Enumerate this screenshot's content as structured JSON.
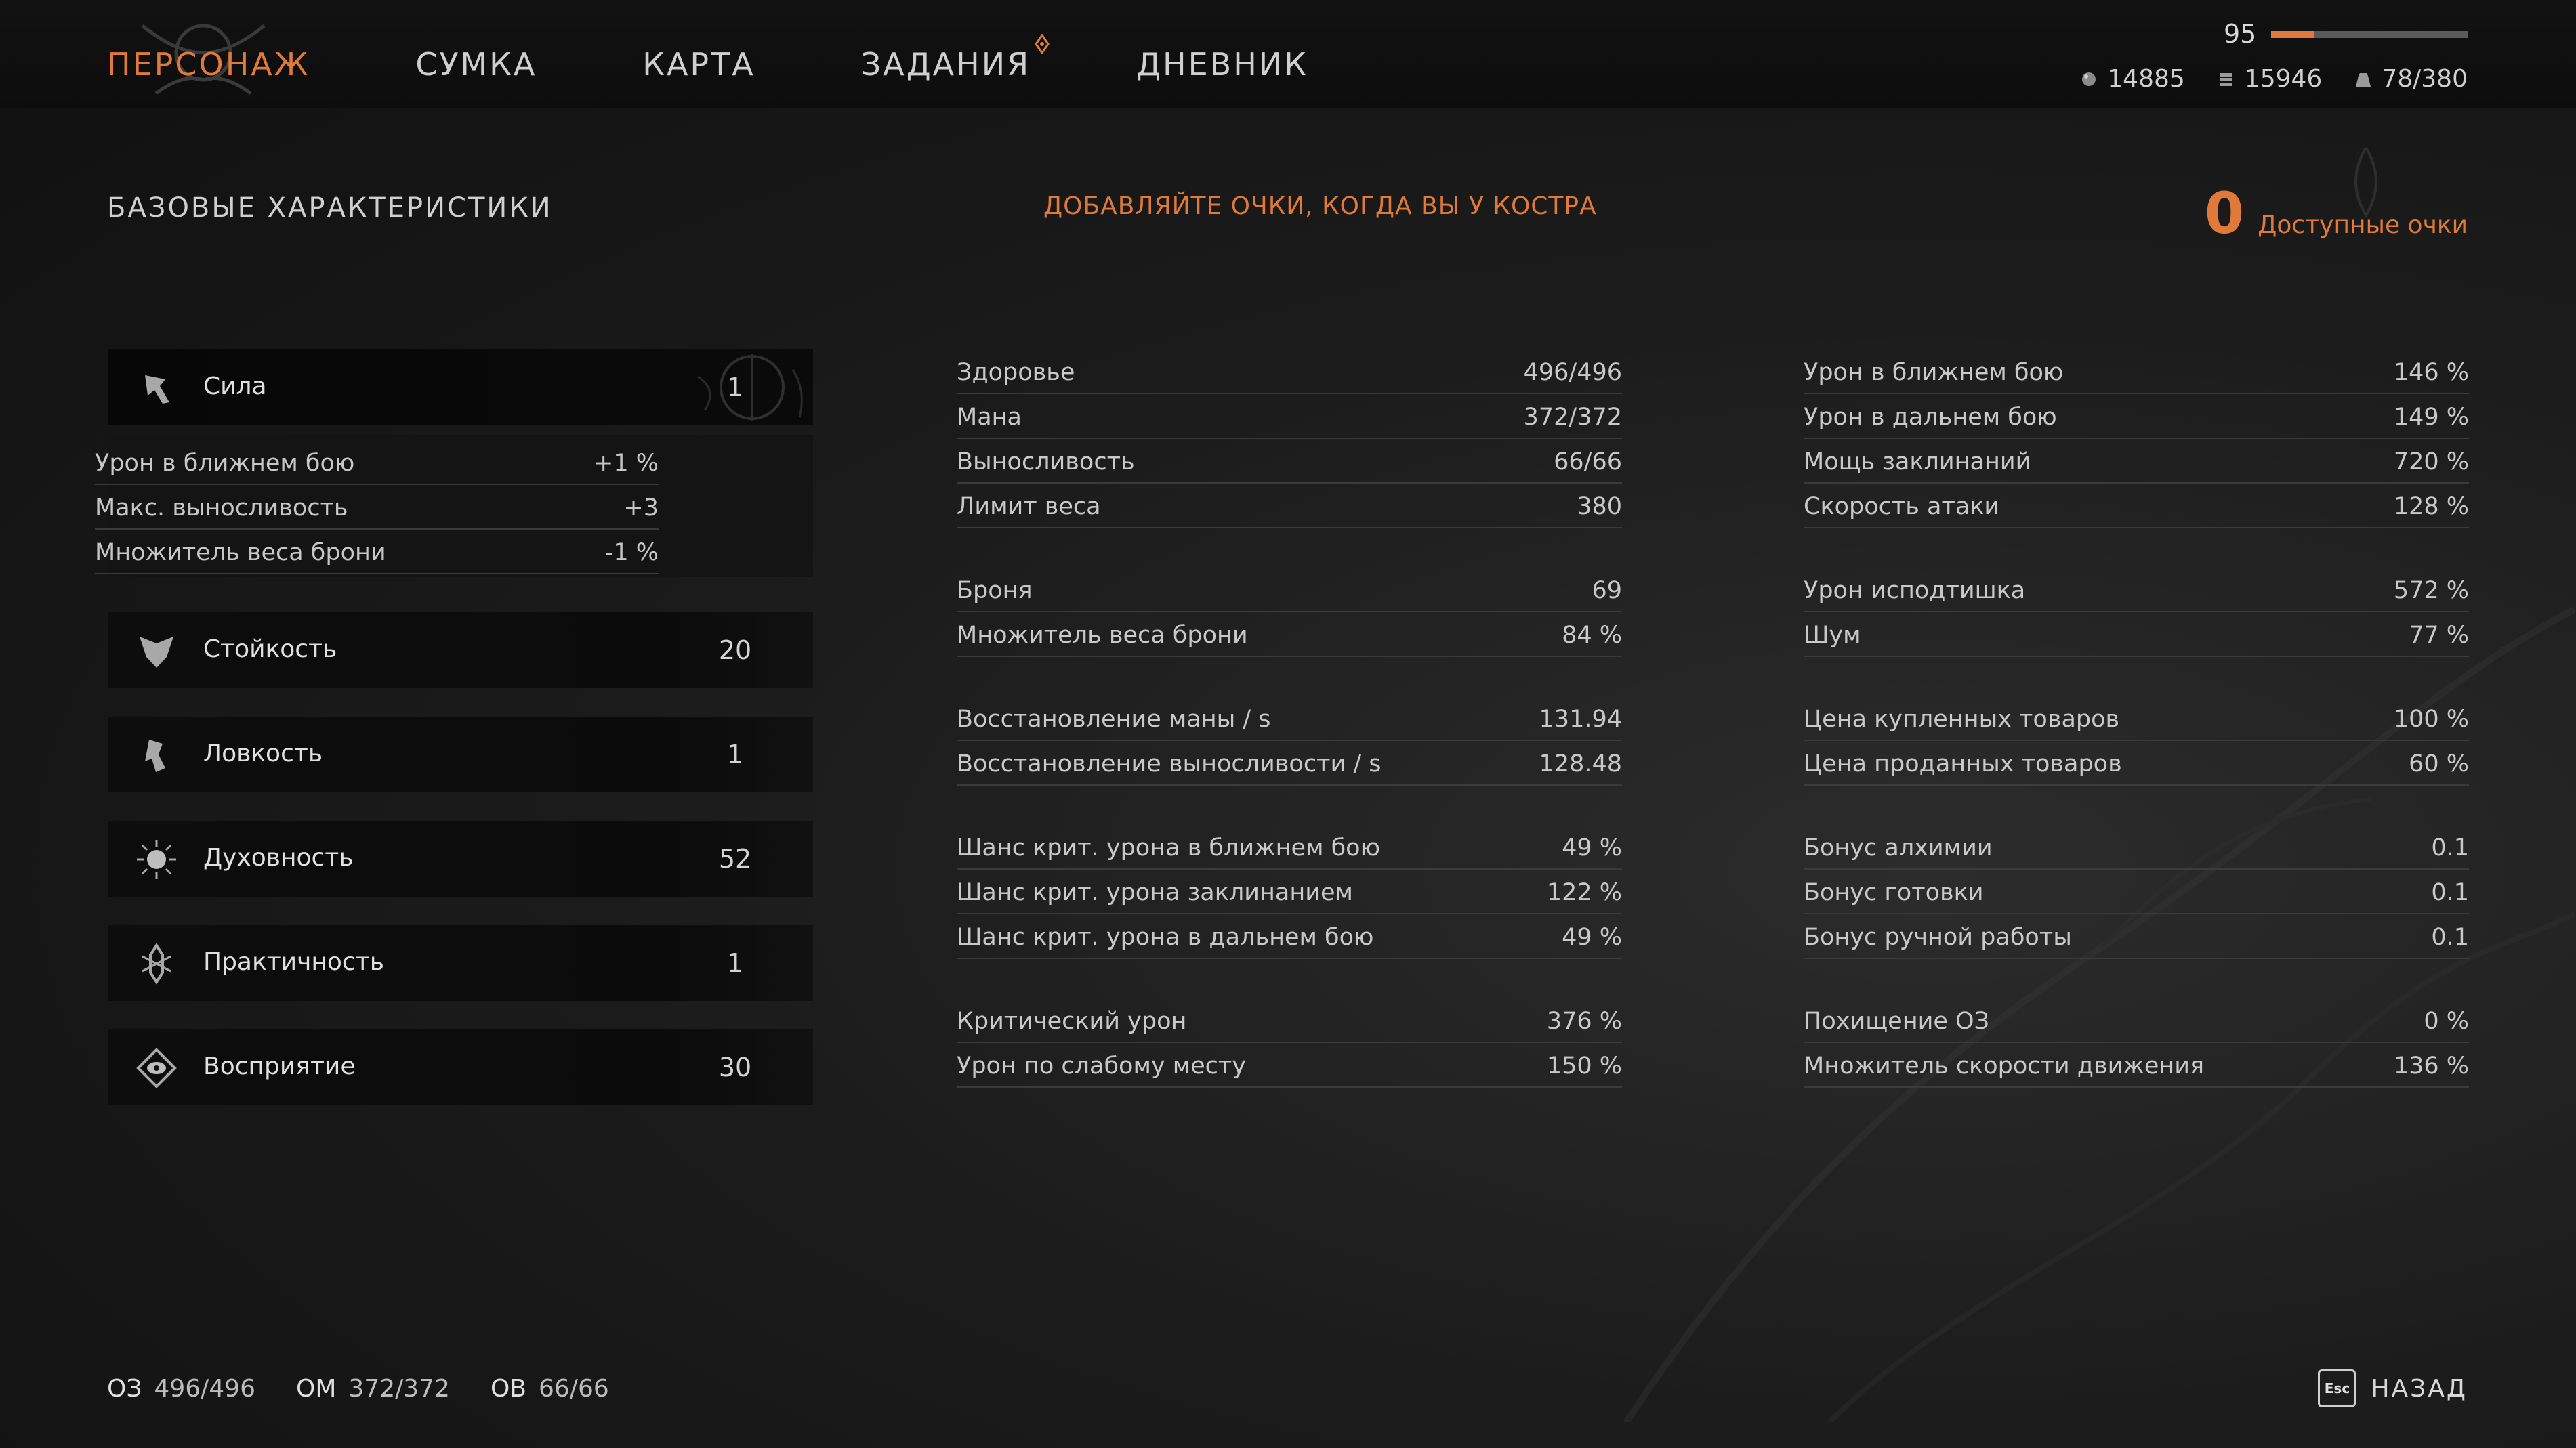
{
  "nav": {
    "tabs": [
      {
        "label": "ПЕРСОНАЖ",
        "active": true
      },
      {
        "label": "СУМКА",
        "active": false
      },
      {
        "label": "КАРТА",
        "active": false
      },
      {
        "label": "ЗАДАНИЯ",
        "active": false,
        "badge_icon": "quest-marker-icon"
      },
      {
        "label": "ДНЕВНИК",
        "active": false
      }
    ]
  },
  "header": {
    "level": "95",
    "level_progress": 0.22,
    "currencies": [
      {
        "icon": "orb-icon",
        "value": "14885"
      },
      {
        "icon": "coin-stack-icon",
        "value": "15946"
      },
      {
        "icon": "weight-icon",
        "value": "78/380"
      }
    ]
  },
  "section_title": "БАЗОВЫЕ ХАРАКТЕРИСТИКИ",
  "hint": "ДОБАВЛЯЙТЕ ОЧКИ, КОГДА ВЫ У КОСТРА",
  "points": {
    "value": "0",
    "label": "Доступные очки"
  },
  "attributes": [
    {
      "name": "Сила",
      "value": "1",
      "icon": "strength-icon",
      "expanded": true
    },
    {
      "name": "Стойкость",
      "value": "20",
      "icon": "endurance-icon"
    },
    {
      "name": "Ловкость",
      "value": "1",
      "icon": "dexterity-icon"
    },
    {
      "name": "Духовность",
      "value": "52",
      "icon": "spirit-icon"
    },
    {
      "name": "Практичность",
      "value": "1",
      "icon": "practicality-icon"
    },
    {
      "name": "Восприятие",
      "value": "30",
      "icon": "perception-icon"
    }
  ],
  "strength_bonuses": [
    {
      "label": "Урон в ближнем бою",
      "value": "+1 %"
    },
    {
      "label": "Макс. выносливость",
      "value": "+3"
    },
    {
      "label": "Множитель веса брони",
      "value": "-1 %"
    }
  ],
  "stats_left": [
    {
      "label": "Здоровье",
      "value": "496/496"
    },
    {
      "label": "Мана",
      "value": "372/372"
    },
    {
      "label": "Выносливость",
      "value": "66/66"
    },
    {
      "label": "Лимит веса",
      "value": "380"
    },
    {
      "label": "Броня",
      "value": "69"
    },
    {
      "label": "Множитель веса брони",
      "value": "84 %"
    },
    {
      "label": "Восстановление маны / s",
      "value": "131.94"
    },
    {
      "label": "Восстановление выносливости / s",
      "value": "128.48"
    },
    {
      "label": "Шанс крит. урона в ближнем бою",
      "value": "49 %"
    },
    {
      "label": "Шанс крит. урона заклинанием",
      "value": "122 %"
    },
    {
      "label": "Шанс крит. урона в дальнем бою",
      "value": "49 %"
    },
    {
      "label": "Критический урон",
      "value": "376 %"
    },
    {
      "label": "Урон по слабому месту",
      "value": "150 %"
    }
  ],
  "stats_right": [
    {
      "label": "Урон в ближнем бою",
      "value": "146 %"
    },
    {
      "label": "Урон в дальнем бою",
      "value": "149 %"
    },
    {
      "label": "Мощь заклинаний",
      "value": "720 %"
    },
    {
      "label": "Скорость атаки",
      "value": "128 %"
    },
    {
      "label": "Урон исподтишка",
      "value": "572 %"
    },
    {
      "label": "Шум",
      "value": "77 %"
    },
    {
      "label": "Цена купленных товаров",
      "value": "100 %"
    },
    {
      "label": "Цена проданных товаров",
      "value": "60 %"
    },
    {
      "label": "Бонус алхимии",
      "value": "0.1"
    },
    {
      "label": "Бонус готовки",
      "value": "0.1"
    },
    {
      "label": "Бонус ручной работы",
      "value": "0.1"
    },
    {
      "label": "Похищение ОЗ",
      "value": "0 %"
    },
    {
      "label": "Множитель скорости движения",
      "value": "136 %"
    }
  ],
  "footer": [
    {
      "label": "ОЗ",
      "value": "496/496"
    },
    {
      "label": "ОМ",
      "value": "372/372"
    },
    {
      "label": "ОВ",
      "value": "66/66"
    }
  ],
  "back": {
    "key": "Esc",
    "label": "НАЗАД"
  }
}
